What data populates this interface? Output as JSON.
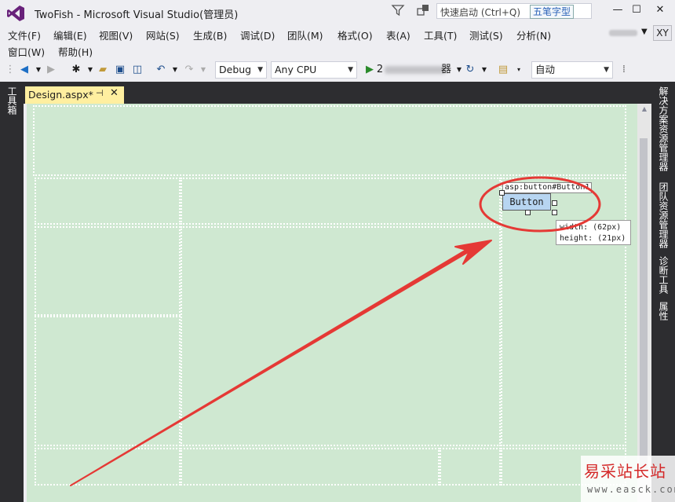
{
  "window": {
    "title": "TwoFish - Microsoft Visual Studio(管理员)",
    "quick_launch_placeholder": "快速启动 (Ctrl+Q)",
    "ime_badge": "五笔字型",
    "minimize": "—",
    "maximize": "☐",
    "close": "✕"
  },
  "menu": {
    "items": [
      "文件(F)",
      "编辑(E)",
      "视图(V)",
      "网站(S)",
      "生成(B)",
      "调试(D)",
      "团队(M)",
      "格式(O)",
      "表(A)",
      "工具(T)",
      "测试(S)",
      "分析(N)"
    ],
    "items_row2": [
      "窗口(W)",
      "帮助(H)"
    ],
    "avatar": "XY"
  },
  "toolbar": {
    "config": "Debug",
    "platform": "Any CPU",
    "run_prefix": "2",
    "run_suffix": "器",
    "zoom": "自动"
  },
  "left_rail": {
    "toolbox": "工具箱"
  },
  "right_rail": {
    "tabs": [
      "解决方案资源管理器",
      "团队资源管理器",
      "诊断工具",
      "属性"
    ]
  },
  "document": {
    "tab_label": "Design.aspx*",
    "pin": "⊣",
    "close": "✕"
  },
  "control": {
    "selector": "asp:button#Button1",
    "label": "Button",
    "tooltip_width": "width: (62px)",
    "tooltip_height": "height: (21px)"
  },
  "annotation": {
    "color": "#e53935"
  },
  "watermark": {
    "title": "易采站长站",
    "url": "www.easck.com"
  }
}
